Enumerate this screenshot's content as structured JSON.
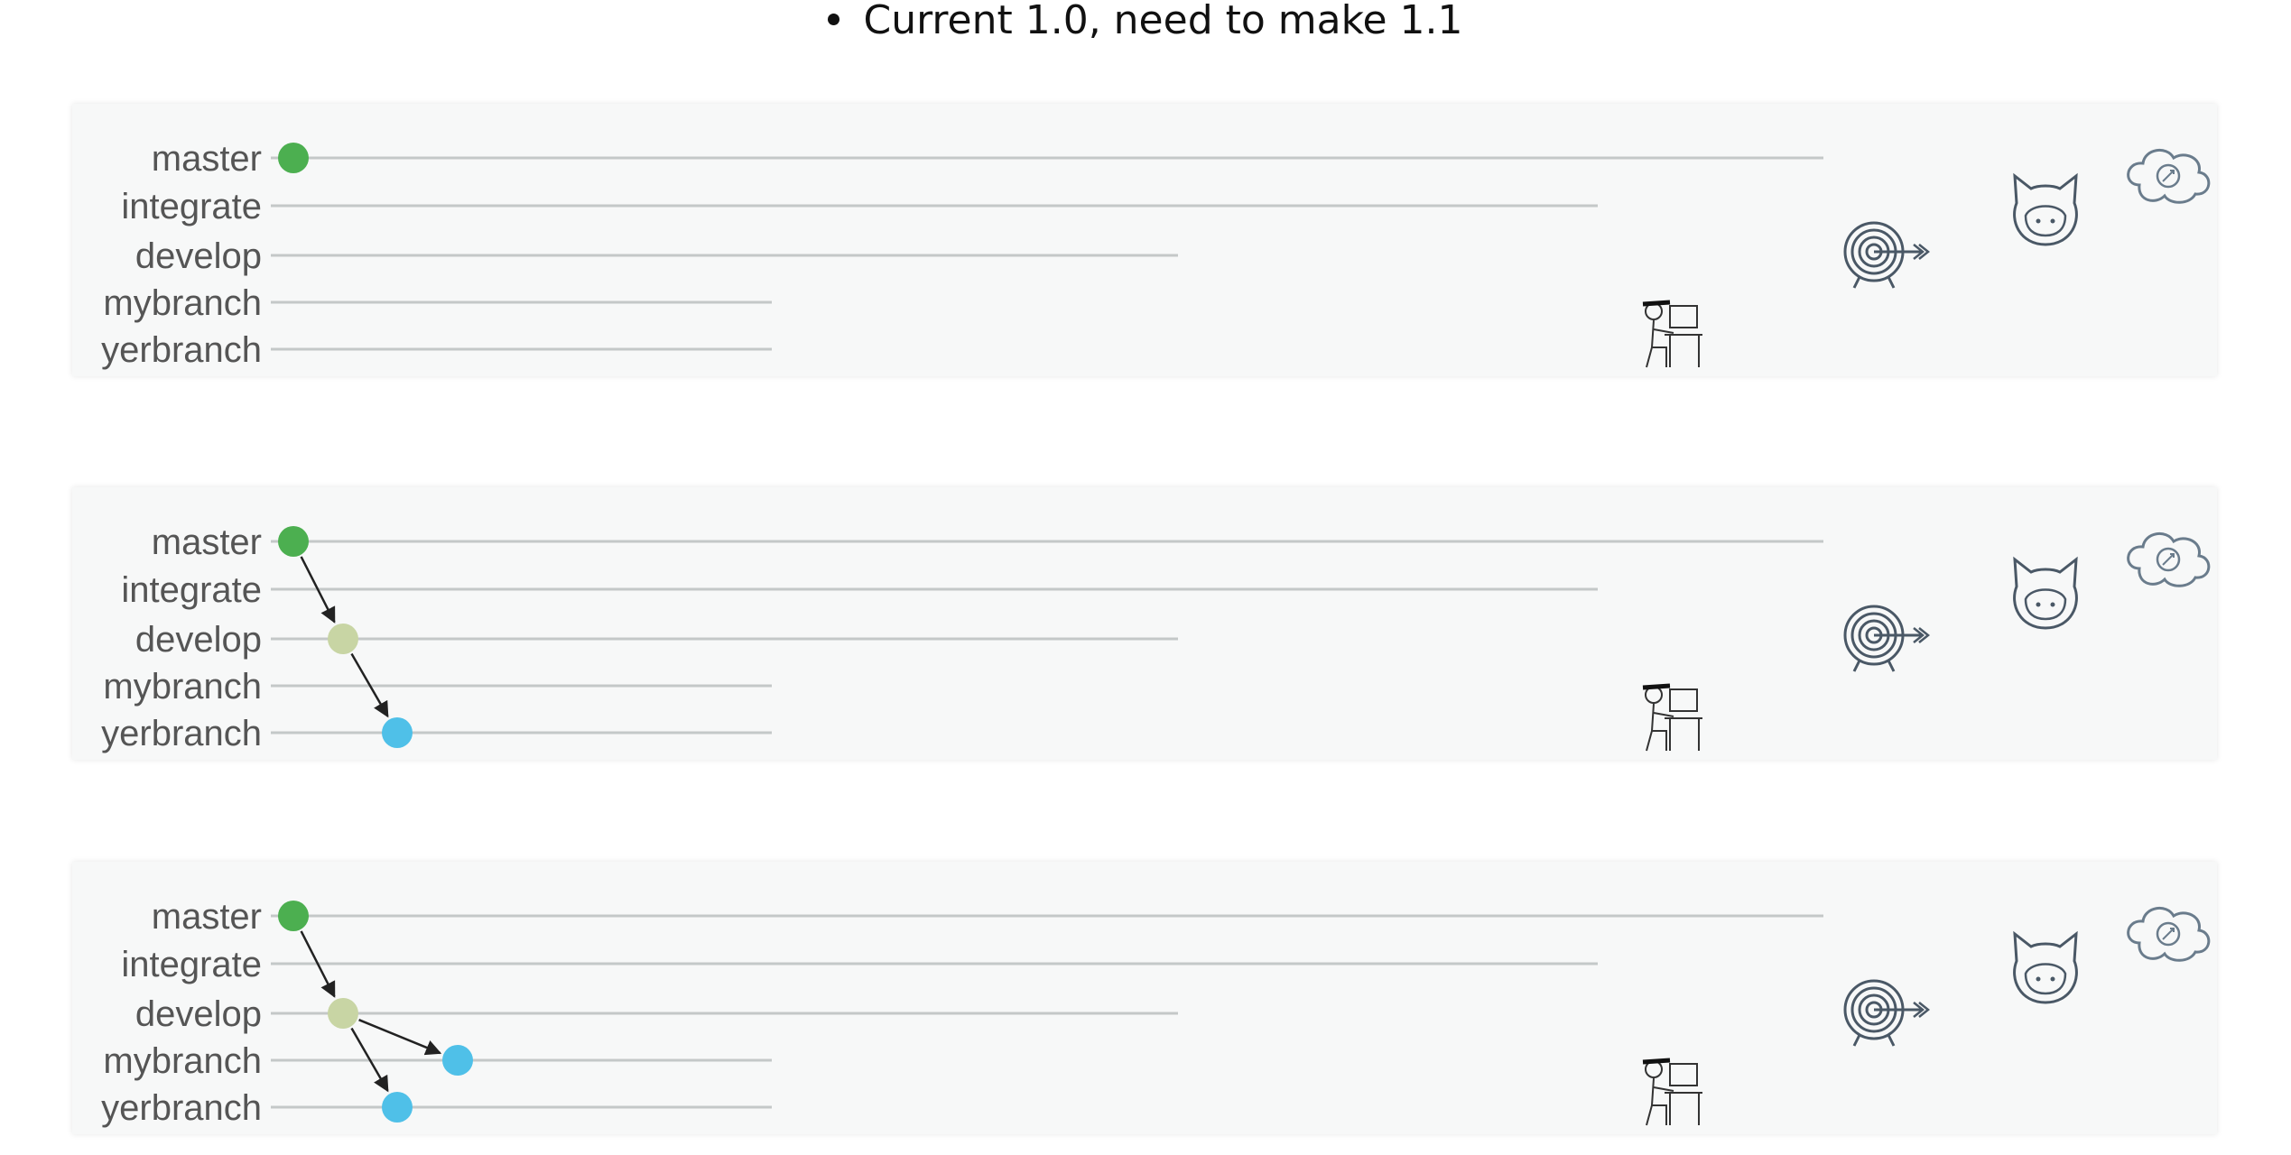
{
  "bullet": {
    "text": "Current 1.0, need to make 1.1"
  },
  "branches": [
    "master",
    "integrate",
    "develop",
    "mybranch",
    "yerbranch"
  ],
  "colors": {
    "master_commit": "#4caf50",
    "develop_commit": "#c8d5a4",
    "feature_commit": "#4fc0e8",
    "line": "#c4c8c8",
    "label": "#555555",
    "arrow": "#222222"
  },
  "icons": [
    "cloud-icon",
    "octocat-icon",
    "target-icon",
    "stick-figure-desk-icon"
  ],
  "panels": [
    {
      "commits": [
        {
          "branch": "master",
          "color": "master_commit"
        }
      ],
      "arrows": []
    },
    {
      "commits": [
        {
          "branch": "master",
          "color": "master_commit"
        },
        {
          "branch": "develop",
          "color": "develop_commit"
        },
        {
          "branch": "yerbranch",
          "color": "feature_commit"
        }
      ],
      "arrows": [
        [
          "master",
          "develop"
        ],
        [
          "develop",
          "yerbranch"
        ]
      ]
    },
    {
      "commits": [
        {
          "branch": "master",
          "color": "master_commit"
        },
        {
          "branch": "develop",
          "color": "develop_commit"
        },
        {
          "branch": "mybranch",
          "color": "feature_commit"
        },
        {
          "branch": "yerbranch",
          "color": "feature_commit"
        }
      ],
      "arrows": [
        [
          "master",
          "develop"
        ],
        [
          "develop",
          "mybranch"
        ],
        [
          "develop",
          "yerbranch"
        ]
      ]
    }
  ]
}
